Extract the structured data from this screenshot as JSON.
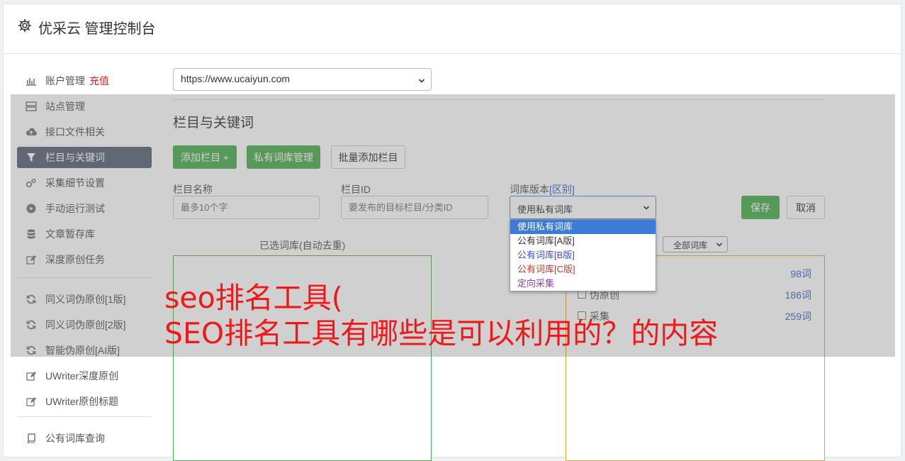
{
  "header": {
    "title": "优采云 管理控制台",
    "icon": "gear-icon"
  },
  "sidebar": {
    "account": {
      "label": "账户管理",
      "recharge": "充值",
      "icon": "bar-chart-icon"
    },
    "items": [
      {
        "label": "站点管理",
        "icon": "server-icon"
      },
      {
        "label": "接口文件相关",
        "icon": "cloud-upload-icon"
      },
      {
        "label": "栏目与关键词",
        "icon": "filter-icon",
        "active": true
      },
      {
        "label": "采集细节设置",
        "icon": "gears-icon"
      },
      {
        "label": "手动运行测试",
        "icon": "play-circle-icon"
      },
      {
        "label": "文章暂存库",
        "icon": "database-icon"
      },
      {
        "label": "深度原创任务",
        "icon": "edit-icon"
      }
    ],
    "group2": [
      {
        "label": "同义词伪原创[1版]",
        "icon": "refresh-icon"
      },
      {
        "label": "同义词伪原创[2版]",
        "icon": "refresh-icon"
      },
      {
        "label": "智能伪原创[AI版]",
        "icon": "refresh-icon"
      },
      {
        "label": "UWriter深度原创",
        "icon": "edit-icon"
      },
      {
        "label": "UWriter原创标题",
        "icon": "edit-icon"
      }
    ],
    "group3": [
      {
        "label": "公有词库查询",
        "icon": "book-icon"
      }
    ]
  },
  "site_select": {
    "value": "https://www.ucaiyun.com"
  },
  "section": {
    "title": "栏目与关键词"
  },
  "buttons": {
    "add_column": "添加栏目 +",
    "private_lib": "私有词库管理",
    "batch_add": "批量添加栏目",
    "save": "保存",
    "cancel": "取消"
  },
  "form": {
    "column_name_label": "栏目名称",
    "column_name_placeholder": "最多10个字",
    "column_id_label": "栏目ID",
    "column_id_placeholder": "要发布的目标栏目/分类ID",
    "lib_version_label": "词库版本",
    "lib_version_link": "[区别]",
    "lib_version_value": "使用私有词库"
  },
  "dropdown": {
    "options": [
      {
        "label": "使用私有词库",
        "color": "#ffffff",
        "selected": true
      },
      {
        "label": "公有词库[A版]",
        "color": "#333333"
      },
      {
        "label": "公有词库[B版]",
        "color": "#3a4bd0"
      },
      {
        "label": "公有词库[C版]",
        "color": "#c0392b"
      },
      {
        "label": "定向采集",
        "color": "#8e44ad"
      }
    ]
  },
  "panels": {
    "selected_label": "已选词库(自动去重)",
    "filter_value": "全部词库",
    "libs": [
      {
        "name": "",
        "count": "98词"
      },
      {
        "name": "伪原创",
        "count": "186词"
      },
      {
        "name": "采集",
        "count": "259词"
      }
    ]
  },
  "overlay": {
    "line1": "seo排名工具(",
    "line2": "SEO排名工具有哪些是可以利用的？的内容"
  },
  "colors": {
    "accent_green": "#4caf50",
    "active_nav": "#5b6678",
    "overlay_text": "#f01818",
    "link_blue": "#3a66c6"
  }
}
